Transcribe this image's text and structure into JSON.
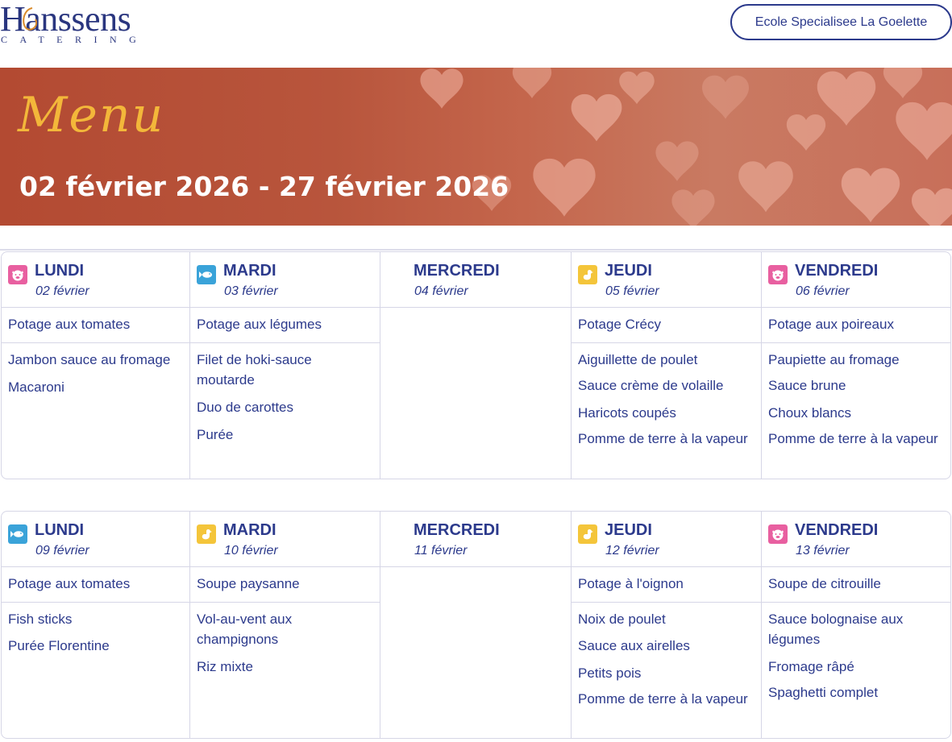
{
  "header": {
    "logo_text": "Hanssens",
    "logo_sub": "CATERING",
    "school_button": "Ecole Specialisee La Goelette"
  },
  "banner": {
    "title": "Menu",
    "date_range": "02 février 2026 - 27 février 2026"
  },
  "colors": {
    "primary": "#2c3a8c",
    "banner": "#b8553c",
    "gold": "#f3b73a",
    "pork": "#e85fa0",
    "fish": "#3aa3d9",
    "poultry": "#f4c53a"
  },
  "weeks": [
    {
      "days": [
        {
          "name": "LUNDI",
          "date": "02 février",
          "icon": "pig-icon",
          "soup": "Potage aux tomates",
          "dishes": [
            "Jambon sauce au fromage",
            "Macaroni"
          ]
        },
        {
          "name": "MARDI",
          "date": "03 février",
          "icon": "fish-icon",
          "soup": "Potage aux légumes",
          "dishes": [
            "Filet de hoki-sauce moutarde",
            "Duo de carottes",
            "Purée"
          ]
        },
        {
          "name": "MERCREDI",
          "date": "04 février",
          "icon": "",
          "soup": "",
          "dishes": []
        },
        {
          "name": "JEUDI",
          "date": "05 février",
          "icon": "chicken-icon",
          "soup": "Potage Crécy",
          "dishes": [
            "Aiguillette de poulet",
            "Sauce crème de volaille",
            "Haricots coupés",
            "Pomme de terre à la vapeur"
          ]
        },
        {
          "name": "VENDREDI",
          "date": "06 février",
          "icon": "pig-icon",
          "soup": "Potage aux poireaux",
          "dishes": [
            "Paupiette au fromage",
            "Sauce brune",
            "Choux blancs",
            "Pomme de terre à la vapeur"
          ]
        }
      ]
    },
    {
      "days": [
        {
          "name": "LUNDI",
          "date": "09 février",
          "icon": "fish-icon",
          "soup": "Potage aux tomates",
          "dishes": [
            "Fish sticks",
            "Purée Florentine"
          ]
        },
        {
          "name": "MARDI",
          "date": "10 février",
          "icon": "chicken-icon",
          "soup": "Soupe paysanne",
          "dishes": [
            "Vol-au-vent aux champignons",
            "Riz mixte"
          ]
        },
        {
          "name": "MERCREDI",
          "date": "11 février",
          "icon": "",
          "soup": "",
          "dishes": []
        },
        {
          "name": "JEUDI",
          "date": "12 février",
          "icon": "chicken-icon",
          "soup": "Potage à l'oignon",
          "dishes": [
            "Noix de poulet",
            "Sauce aux airelles",
            "Petits pois",
            "Pomme de terre à la vapeur"
          ]
        },
        {
          "name": "VENDREDI",
          "date": "13 février",
          "icon": "pig-icon",
          "soup": "Soupe de citrouille",
          "dishes": [
            "Sauce bolognaise aux légumes",
            "Fromage râpé",
            "Spaghetti complet"
          ]
        }
      ]
    }
  ]
}
